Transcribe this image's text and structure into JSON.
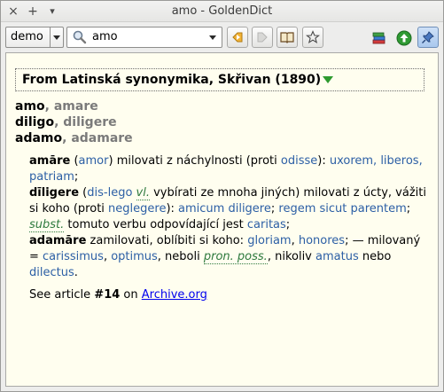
{
  "titlebar": {
    "title": "amo - GoldenDict",
    "left_buttons": [
      "×",
      "+",
      "▾"
    ]
  },
  "toolbar": {
    "group_value": "demo",
    "search_value": "amo",
    "icons": [
      "search-icon",
      "back-icon",
      "forward-icon",
      "book-icon",
      "star-icon",
      "books-icon",
      "up-arrow-icon",
      "pin-icon"
    ]
  },
  "article": {
    "dict_title": "From Latinská synonymika, Skřivan (1890)",
    "headwords": [
      {
        "word": "amo",
        "alt": ", amare"
      },
      {
        "word": "diligo",
        "alt": ", diligere"
      },
      {
        "word": "adamo",
        "alt": ", adamare"
      }
    ],
    "entries": {
      "e1_head": "amāre",
      "e1_t1": "(",
      "e1_l1": "amor",
      "e1_t2": ") milovati z náchylnosti (proti ",
      "e1_l2": "odisse",
      "e1_t3": "): ",
      "e1_l3": "uxorem, liberos, patriam",
      "e1_t4": ";",
      "e2_head": "dīligere",
      "e2_t1": "(",
      "e2_l1": "dis-lego",
      "e2_i1": "vl.",
      "e2_t2": " vybírati ze mnoha jiných) milovati z úcty, vážiti si koho (proti ",
      "e2_l2": "neglegere",
      "e2_t3": "): ",
      "e2_l3": "amicum diligere",
      "e2_t4": "; ",
      "e2_l4": "regem sicut parentem",
      "e2_t5": ";",
      "e2_i2": "subst.",
      "e2_t6": " tomuto verbu odpovídající jest ",
      "e2_l5": "caritas",
      "e2_t7": ";",
      "e3_head": "adamāre",
      "e3_t1": " zamilovati, oblíbiti si koho: ",
      "e3_l1": "gloriam",
      "e3_t2": ", ",
      "e3_l2": "honores",
      "e3_t3": "; — milovaný = ",
      "e3_l3": "carissimus",
      "e3_t4": ", ",
      "e3_l4": "optimus",
      "e3_t5": ", neboli ",
      "e3_i1": "pron. poss.",
      "e3_t6": ", nikoliv ",
      "e3_l5": "amatus",
      "e3_t7": " nebo",
      "e3_l6": "dilectus",
      "e3_t8": "."
    },
    "see": {
      "prefix": "See article ",
      "number": "#14",
      "middle": " on ",
      "link": "Archive.org"
    }
  },
  "colors": {
    "article_bg": "#fffeef",
    "link": "#2c5fa5",
    "italic_abbr": "#2f7a3e",
    "headword_alt": "#7a7a7a",
    "title_arrow": "#2e9a2e"
  }
}
